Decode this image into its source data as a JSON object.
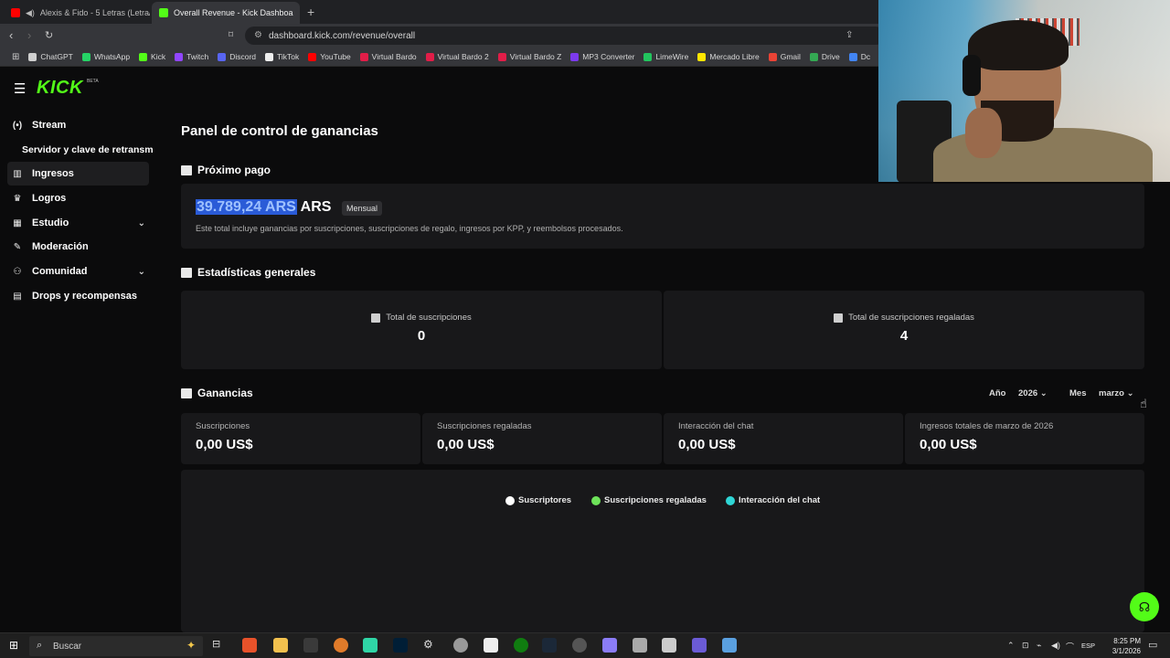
{
  "browser": {
    "tabs": [
      {
        "label": "Alexis & Fido - 5 Letras (Letra/Ly",
        "active": false
      },
      {
        "label": "Overall Revenue - Kick Dashboa",
        "active": true
      }
    ],
    "url": "dashboard.kick.com/revenue/overall",
    "bookmarks": [
      "ChatGPT",
      "WhatsApp",
      "Kick",
      "Twitch",
      "Discord",
      "TikTok",
      "YouTube",
      "Virtual Bardo",
      "Virtual Bardo 2",
      "Virtual Bardo Z",
      "MP3 Converter",
      "LimeWire",
      "Mercado Libre",
      "Gmail",
      "Drive",
      "Dc"
    ],
    "bookmark_colors": [
      "#cfcfcf",
      "#25d366",
      "#53fc18",
      "#9146ff",
      "#5865f2",
      "#eeeeee",
      "#ff0000",
      "#e11d48",
      "#e11d48",
      "#e11d48",
      "#7c3aed",
      "#22c55e",
      "#ffe600",
      "#ea4335",
      "#34a853",
      "#4285f4"
    ]
  },
  "sidebar": {
    "logo": "KICK",
    "logo_badge": "BETA",
    "items": [
      {
        "label": "Stream",
        "icon": "broadcast-icon",
        "glyph": "(•)"
      },
      {
        "label": "Servidor y clave de retransm",
        "icon": "",
        "glyph": ""
      },
      {
        "label": "Ingresos",
        "icon": "chart-icon",
        "glyph": "▥"
      },
      {
        "label": "Logros",
        "icon": "trophy-icon",
        "glyph": "♛"
      },
      {
        "label": "Estudio",
        "icon": "studio-icon",
        "glyph": "▦"
      },
      {
        "label": "Moderación",
        "icon": "wrench-icon",
        "glyph": "✎"
      },
      {
        "label": "Comunidad",
        "icon": "people-icon",
        "glyph": "⚇"
      },
      {
        "label": "Drops y recompensas",
        "icon": "gift-icon",
        "glyph": "▤"
      }
    ]
  },
  "main": {
    "title": "Panel de control de ganancias",
    "next_payment": {
      "heading": "Próximo pago",
      "amount_highlighted": "39.789,24 ARS",
      "amount_rest": " ARS",
      "badge": "Mensual",
      "description": "Este total incluye ganancias por suscripciones, suscripciones de regalo, ingresos por KPP, y reembolsos procesados."
    },
    "stats": {
      "heading": "Estadísticas generales",
      "items": [
        {
          "label": "Total de suscripciones",
          "value": "0"
        },
        {
          "label": "Total de suscripciones regaladas",
          "value": "4"
        }
      ]
    },
    "earnings": {
      "heading": "Ganancias",
      "year_label": "Año",
      "year_value": "2026",
      "month_label": "Mes",
      "month_value": "marzo",
      "items": [
        {
          "label": "Suscripciones",
          "value": "0,00 US$"
        },
        {
          "label": "Suscripciones regaladas",
          "value": "0,00 US$"
        },
        {
          "label": "Interacción del chat",
          "value": "0,00 US$"
        },
        {
          "label": "Ingresos totales de marzo de 2026",
          "value": "0,00 US$"
        }
      ],
      "legend": [
        {
          "label": "Suscriptores",
          "color": "#ffffff"
        },
        {
          "label": "Suscripciones regaladas",
          "color": "#6ee35a"
        },
        {
          "label": "Interacción del chat",
          "color": "#2fd6d6"
        }
      ]
    }
  },
  "taskbar": {
    "search_placeholder": "Buscar",
    "lang": "ESP",
    "time": "8:25 PM",
    "date": "3/1/2026"
  }
}
